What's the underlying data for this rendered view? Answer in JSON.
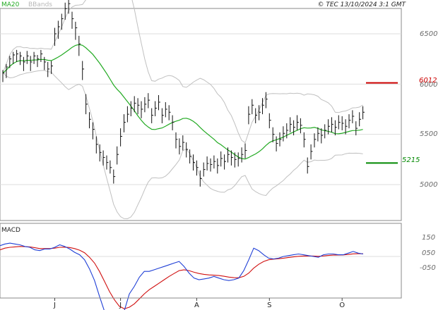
{
  "header": {
    "ma_label": "MA20",
    "bbands_label": "BBands",
    "credit": "© TEC 13/10/2024 3:1 GMT"
  },
  "colors": {
    "ma": "#22aa22",
    "bbands": "#c0c0c0",
    "price_bars": "#111111",
    "resistance": "#cc0000",
    "support": "#008800",
    "macd": "#1f3fd6",
    "signal": "#d01010",
    "grid": "#dddddd"
  },
  "chart_data": [
    {
      "type": "line",
      "title": "",
      "y_ticks": [
        "6500",
        "6000",
        "5500",
        "5000"
      ],
      "ylim": [
        4850,
        6950
      ],
      "resistance": {
        "label": "6012",
        "value": 6012
      },
      "support": {
        "label": "5215",
        "value": 5215
      },
      "x_ticks": [
        {
          "label": "J",
          "day": 15
        },
        {
          "label": "J",
          "day": 34
        },
        {
          "label": "A",
          "day": 56
        },
        {
          "label": "S",
          "day": 77
        },
        {
          "label": "O",
          "day": 98
        }
      ],
      "days": 105,
      "bars": [
        [
          6110,
          6140,
          6020
        ],
        [
          6170,
          6200,
          6060
        ],
        [
          6250,
          6280,
          6160
        ],
        [
          6290,
          6320,
          6200
        ],
        [
          6300,
          6340,
          6220
        ],
        [
          6280,
          6320,
          6190
        ],
        [
          6220,
          6270,
          6130
        ],
        [
          6280,
          6330,
          6200
        ],
        [
          6220,
          6280,
          6130
        ],
        [
          6280,
          6320,
          6200
        ],
        [
          6250,
          6290,
          6170
        ],
        [
          6300,
          6340,
          6220
        ],
        [
          6220,
          6270,
          6140
        ],
        [
          6150,
          6220,
          6070
        ],
        [
          6180,
          6230,
          6100
        ],
        [
          6500,
          6560,
          6380
        ],
        [
          6570,
          6630,
          6450
        ],
        [
          6650,
          6700,
          6540
        ],
        [
          6750,
          6810,
          6640
        ],
        [
          6800,
          6880,
          6700
        ],
        [
          6650,
          6720,
          6550
        ],
        [
          6560,
          6620,
          6440
        ],
        [
          6400,
          6480,
          6280
        ],
        [
          6150,
          6230,
          6040
        ],
        [
          5800,
          5900,
          5700
        ],
        [
          5650,
          5720,
          5560
        ],
        [
          5550,
          5620,
          5450
        ],
        [
          5400,
          5480,
          5310
        ],
        [
          5320,
          5400,
          5230
        ],
        [
          5270,
          5340,
          5190
        ],
        [
          5220,
          5290,
          5150
        ],
        [
          5170,
          5240,
          5110
        ],
        [
          5080,
          5150,
          5010
        ],
        [
          5300,
          5380,
          5200
        ],
        [
          5480,
          5560,
          5380
        ],
        [
          5620,
          5700,
          5520
        ],
        [
          5700,
          5780,
          5620
        ],
        [
          5760,
          5830,
          5680
        ],
        [
          5810,
          5880,
          5720
        ],
        [
          5790,
          5860,
          5700
        ],
        [
          5750,
          5830,
          5660
        ],
        [
          5800,
          5870,
          5720
        ],
        [
          5840,
          5910,
          5760
        ],
        [
          5690,
          5760,
          5610
        ],
        [
          5760,
          5830,
          5680
        ],
        [
          5820,
          5890,
          5740
        ],
        [
          5690,
          5760,
          5610
        ],
        [
          5750,
          5820,
          5670
        ],
        [
          5720,
          5790,
          5640
        ],
        [
          5620,
          5690,
          5540
        ],
        [
          5450,
          5520,
          5360
        ],
        [
          5380,
          5460,
          5300
        ],
        [
          5420,
          5490,
          5340
        ],
        [
          5350,
          5420,
          5270
        ],
        [
          5280,
          5350,
          5210
        ],
        [
          5220,
          5300,
          5140
        ],
        [
          5170,
          5240,
          5090
        ],
        [
          5060,
          5140,
          4980
        ],
        [
          5150,
          5220,
          5080
        ],
        [
          5210,
          5280,
          5140
        ],
        [
          5200,
          5260,
          5130
        ],
        [
          5230,
          5290,
          5160
        ],
        [
          5190,
          5260,
          5110
        ],
        [
          5260,
          5330,
          5180
        ],
        [
          5230,
          5300,
          5150
        ],
        [
          5300,
          5370,
          5220
        ],
        [
          5270,
          5340,
          5190
        ],
        [
          5250,
          5320,
          5170
        ],
        [
          5260,
          5320,
          5180
        ],
        [
          5300,
          5370,
          5220
        ],
        [
          5340,
          5410,
          5260
        ],
        [
          5700,
          5780,
          5600
        ],
        [
          5790,
          5850,
          5700
        ],
        [
          5690,
          5760,
          5610
        ],
        [
          5720,
          5790,
          5640
        ],
        [
          5790,
          5860,
          5700
        ],
        [
          5850,
          5920,
          5760
        ],
        [
          5640,
          5710,
          5560
        ],
        [
          5500,
          5570,
          5420
        ],
        [
          5410,
          5480,
          5330
        ],
        [
          5450,
          5520,
          5380
        ],
        [
          5510,
          5580,
          5430
        ],
        [
          5540,
          5610,
          5460
        ],
        [
          5600,
          5670,
          5520
        ],
        [
          5570,
          5640,
          5490
        ],
        [
          5620,
          5690,
          5540
        ],
        [
          5590,
          5660,
          5510
        ],
        [
          5450,
          5520,
          5370
        ],
        [
          5180,
          5270,
          5110
        ],
        [
          5330,
          5400,
          5250
        ],
        [
          5450,
          5510,
          5370
        ],
        [
          5510,
          5570,
          5430
        ],
        [
          5490,
          5560,
          5410
        ],
        [
          5540,
          5600,
          5460
        ],
        [
          5580,
          5650,
          5500
        ],
        [
          5600,
          5670,
          5520
        ],
        [
          5570,
          5640,
          5490
        ],
        [
          5620,
          5690,
          5550
        ],
        [
          5610,
          5680,
          5540
        ],
        [
          5580,
          5650,
          5500
        ],
        [
          5640,
          5700,
          5560
        ],
        [
          5680,
          5740,
          5610
        ],
        [
          5560,
          5630,
          5490
        ],
        [
          5650,
          5720,
          5580
        ],
        [
          5720,
          5780,
          5650
        ]
      ],
      "macd": [
        130,
        150,
        160,
        150,
        140,
        120,
        110,
        80,
        70,
        90,
        90,
        110,
        140,
        120,
        90,
        50,
        20,
        -40,
        -150,
        -290,
        -480,
        -660,
        -750,
        -820,
        -820,
        -650,
        -450,
        -360,
        -250,
        -180,
        -180,
        -160,
        -140,
        -120,
        -100,
        -80,
        -60,
        -120,
        -200,
        -260,
        -280,
        -270,
        -260,
        -240,
        -260,
        -280,
        -290,
        -280,
        -260,
        -170,
        -40,
        100,
        70,
        20,
        -20,
        -30,
        -20,
        0,
        10,
        20,
        30,
        20,
        10,
        0,
        -10,
        20,
        30,
        30,
        20,
        20,
        40,
        60,
        40,
        30
      ],
      "signal": [
        80,
        100,
        110,
        115,
        120,
        118,
        115,
        105,
        95,
        95,
        95,
        100,
        110,
        112,
        108,
        95,
        75,
        45,
        -10,
        -80,
        -180,
        -300,
        -420,
        -520,
        -600,
        -630,
        -610,
        -570,
        -510,
        -450,
        -400,
        -360,
        -320,
        -280,
        -240,
        -205,
        -170,
        -160,
        -170,
        -190,
        -205,
        -215,
        -222,
        -225,
        -230,
        -238,
        -248,
        -255,
        -256,
        -240,
        -200,
        -140,
        -95,
        -60,
        -40,
        -32,
        -27,
        -20,
        -12,
        -5,
        2,
        5,
        6,
        5,
        2,
        6,
        12,
        16,
        18,
        19,
        24,
        31,
        33,
        32
      ],
      "macd_y_ticks": [
        "150",
        "050",
        "-050"
      ]
    }
  ]
}
